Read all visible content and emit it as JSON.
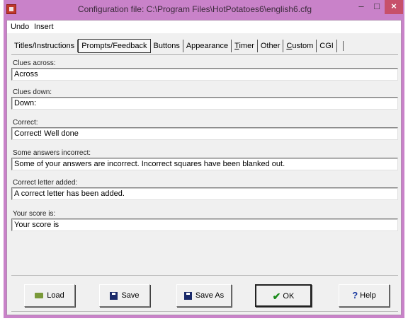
{
  "window": {
    "title": "Configuration file: C:\\Program Files\\HotPotatoes6\\english6.cfg",
    "controls": {
      "minimize": "–",
      "maximize": "□",
      "close": "×"
    }
  },
  "menu": {
    "items": [
      "Undo",
      "Insert"
    ]
  },
  "tabs": [
    {
      "label": "Titles/Instructions",
      "active": false
    },
    {
      "label": "Prompts/Feedback",
      "active": true
    },
    {
      "label": "Buttons",
      "active": false
    },
    {
      "label": "Appearance",
      "active": false
    },
    {
      "label": "Timer",
      "active": false
    },
    {
      "label": "Other",
      "active": false
    },
    {
      "label": "Custom",
      "active": false
    },
    {
      "label": "CGI",
      "active": false
    }
  ],
  "fields": [
    {
      "label": "Clues across:",
      "value": "Across"
    },
    {
      "label": "Clues down:",
      "value": "Down:"
    },
    {
      "label": "Correct:",
      "value": "Correct! Well done"
    },
    {
      "label": "Some answers incorrect:",
      "value": "Some of your answers are incorrect. Incorrect squares have been blanked out."
    },
    {
      "label": "Correct letter added:",
      "value": "A correct letter has been added."
    },
    {
      "label": "Your score is:",
      "value": "Your score is"
    }
  ],
  "buttons": {
    "load": "Load",
    "save": "Save",
    "save_as": "Save As",
    "ok": "OK",
    "help": "Help"
  }
}
